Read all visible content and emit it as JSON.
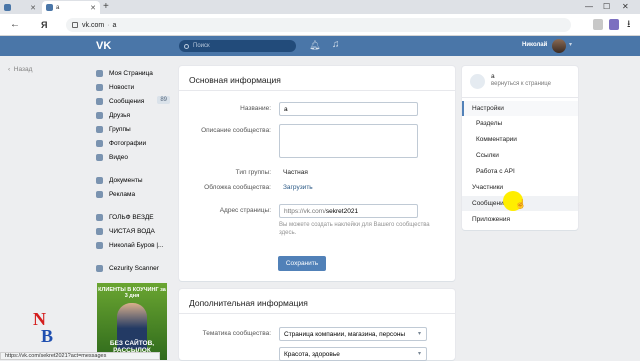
{
  "browser": {
    "tabs": [
      {
        "label": "",
        "active": false
      },
      {
        "label": "a",
        "active": true
      }
    ],
    "new_tab": "+",
    "window_controls": [
      "—",
      "☐",
      "✕"
    ],
    "url_host": "vk.com",
    "url_title": "a",
    "ya_button": "Я",
    "status_url": "https://vk.com/sekret2021?act=messages"
  },
  "vk_header": {
    "logo": "VK",
    "search_placeholder": "Поиск",
    "user_name": "Николай"
  },
  "back_link": "Назад",
  "left_nav": {
    "items": [
      {
        "label": "Моя Страница"
      },
      {
        "label": "Новости"
      },
      {
        "label": "Сообщения",
        "count": "89"
      },
      {
        "label": "Друзья"
      },
      {
        "label": "Группы"
      },
      {
        "label": "Фотографии"
      },
      {
        "label": "Видео"
      }
    ],
    "items2": [
      {
        "label": "Документы"
      },
      {
        "label": "Реклама"
      }
    ],
    "items3": [
      {
        "label": "ГОЛЬФ ВЕЗДЕ"
      },
      {
        "label": "ЧИСТАЯ ВОДА"
      },
      {
        "label": "Николай Буров |..."
      }
    ],
    "items4": [
      {
        "label": "Cezurity Scanner"
      }
    ]
  },
  "promo": {
    "top": "КЛИЕНТЫ В КОУЧИНГ за 3 дня",
    "bottom": "БЕЗ САЙТОВ, РАССЫЛОК"
  },
  "main_info": {
    "title": "Основная информация",
    "name_label": "Название:",
    "name_value": "a",
    "desc_label": "Описание сообщества:",
    "desc_value": "",
    "type_label": "Тип группы:",
    "type_value": "Частная",
    "cover_label": "Обложка сообщества:",
    "cover_value": "Загрузить",
    "address_label": "Адрес страницы:",
    "address_prefix": "https://vk.com/",
    "address_value": "sekret2021",
    "hint": "Вы можете создать наклейки для Вашего сообщества здесь.",
    "save_button": "Сохранить"
  },
  "extra_info": {
    "title": "Дополнительная информация",
    "theme_label": "Тематика сообщества:",
    "theme_value": "Страница компании, магазина, персоны",
    "subtheme_value": "Красота, здоровье"
  },
  "right_menu": {
    "group_name": "a",
    "group_back": "вернуться к странице",
    "items": [
      {
        "label": "Настройки",
        "active": true
      },
      {
        "label": "Разделы",
        "sub": true
      },
      {
        "label": "Комментарии",
        "sub": true
      },
      {
        "label": "Ссылки",
        "sub": true
      },
      {
        "label": "Работа с API",
        "sub": true
      },
      {
        "label": "Участники"
      },
      {
        "label": "Сообщения",
        "hover": true
      },
      {
        "label": "Приложения"
      }
    ]
  },
  "watermark": {
    "left": "N",
    "right": "B"
  },
  "colors": {
    "vk_blue": "#4a76a8",
    "button": "#5181b8",
    "link": "#2a5885"
  }
}
